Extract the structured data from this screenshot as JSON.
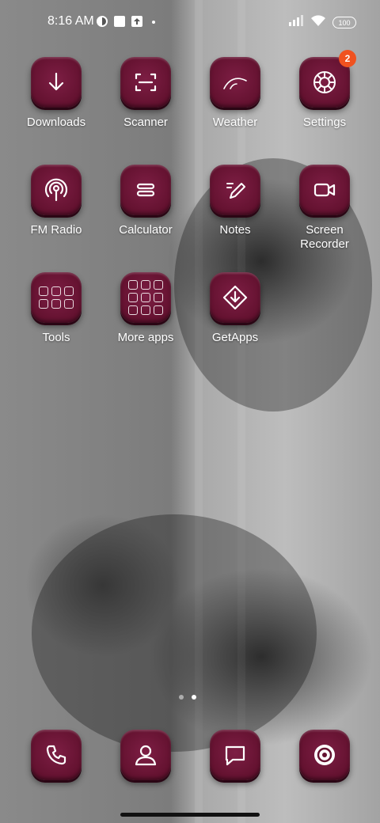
{
  "status_bar": {
    "time": "8:16 AM",
    "battery": "100",
    "left_icons": [
      "data-saver-icon",
      "square-notification-icon",
      "upload-notification-icon"
    ],
    "right_icons": [
      "signal-icon",
      "wifi-icon",
      "battery-icon"
    ]
  },
  "home": {
    "apps": [
      {
        "label": "Downloads",
        "icon": "download-icon"
      },
      {
        "label": "Scanner",
        "icon": "scan-icon"
      },
      {
        "label": "Weather",
        "icon": "weather-icon"
      },
      {
        "label": "Settings",
        "icon": "settings-gear-icon",
        "badge": "2"
      },
      {
        "label": "FM Radio",
        "icon": "radio-icon"
      },
      {
        "label": "Calculator",
        "icon": "calculator-icon"
      },
      {
        "label": "Notes",
        "icon": "notes-icon"
      },
      {
        "label": "Screen Recorder",
        "icon": "video-camera-icon"
      },
      {
        "label": "Tools",
        "icon": "folder-grid-icon"
      },
      {
        "label": "More apps",
        "icon": "folder-grid-icon"
      },
      {
        "label": "GetApps",
        "icon": "getapps-icon"
      }
    ],
    "page_count": 2,
    "active_page": 2
  },
  "dock": [
    {
      "icon": "phone-icon"
    },
    {
      "icon": "contacts-icon"
    },
    {
      "icon": "messages-icon"
    },
    {
      "icon": "browser-icon"
    }
  ],
  "colors": {
    "tile": "#641230",
    "badge": "#f0521f"
  }
}
